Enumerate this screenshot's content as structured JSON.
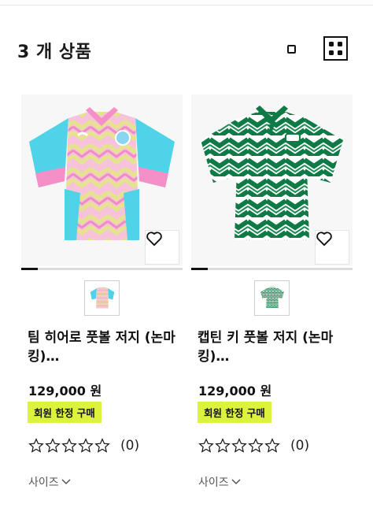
{
  "header": {
    "product_count_title": "3 개 상품",
    "view_options": [
      "single-view-icon",
      "grid-view-icon"
    ]
  },
  "products": [
    {
      "name": "팀 히어로 풋볼 저지 (논마킹)…",
      "price": "129,000 원",
      "badge": "회원 한정 구매",
      "rating_count": "(0)",
      "size_label": "사이즈",
      "image_progress": 0.1,
      "colors": {
        "primary": "#f7b6dc",
        "secondary": "#4fd3e8",
        "accent": "#e7e08a"
      }
    },
    {
      "name": "캡틴 키 풋볼 저지 (논마킹)…",
      "price": "129,000 원",
      "badge": "회원 한정 구매",
      "rating_count": "(0)",
      "size_label": "사이즈",
      "image_progress": 0.1,
      "colors": {
        "primary": "#0f7a45",
        "secondary": "#ffffff",
        "accent": "#1e8c55"
      }
    }
  ],
  "colors": {
    "badge_bg": "#dcf23c",
    "text": "#111111",
    "muted": "#555555"
  }
}
